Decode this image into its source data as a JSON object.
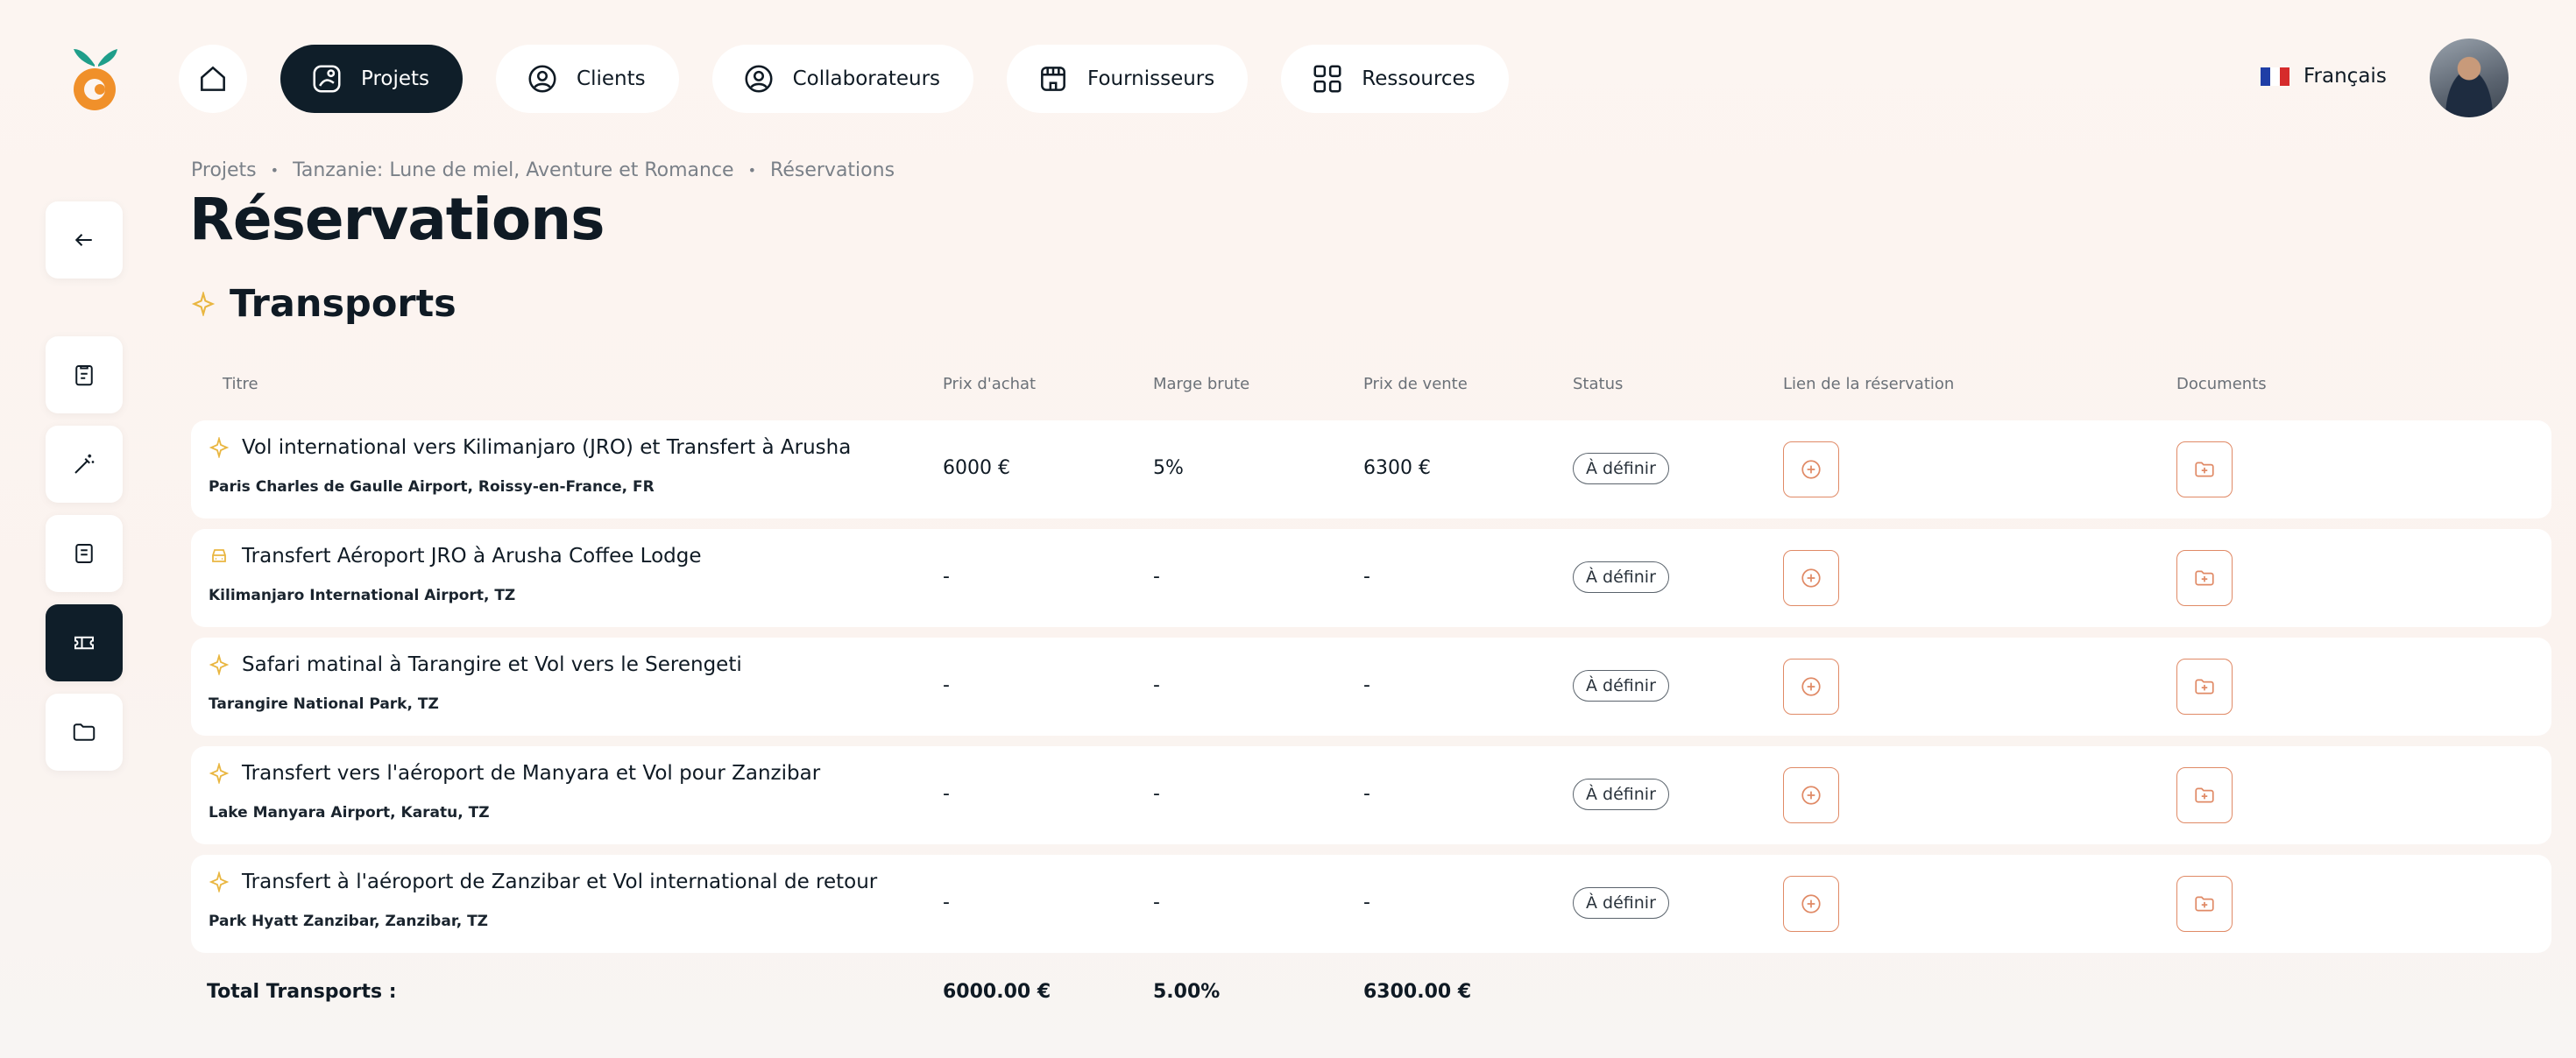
{
  "nav": {
    "items": [
      {
        "label": "Projets",
        "icon": "projects-icon",
        "active": true
      },
      {
        "label": "Clients",
        "icon": "user-circle-icon"
      },
      {
        "label": "Collaborateurs",
        "icon": "user-circle-icon"
      },
      {
        "label": "Fournisseurs",
        "icon": "store-icon"
      },
      {
        "label": "Ressources",
        "icon": "grid-icon"
      }
    ],
    "language": "Français"
  },
  "breadcrumb": [
    "Projets",
    "Tanzanie: Lune de miel, Aventure et Romance",
    "Réservations"
  ],
  "page_title": "Réservations",
  "section": {
    "title": "Transports",
    "icon": "plane-icon"
  },
  "table": {
    "headers": [
      "Titre",
      "Prix d'achat",
      "Marge brute",
      "Prix de vente",
      "Status",
      "Lien de la réservation",
      "Documents"
    ],
    "rows": [
      {
        "icon": "plane-icon",
        "title": "Vol international vers Kilimanjaro (JRO) et Transfert à Arusha",
        "location": "Paris Charles de Gaulle Airport, Roissy-en-France, FR",
        "purchase": "6000 €",
        "margin": "5%",
        "sale": "6300 €",
        "status": "À définir"
      },
      {
        "icon": "car-icon",
        "title": "Transfert Aéroport JRO à Arusha Coffee Lodge",
        "location": "Kilimanjaro International Airport, TZ",
        "purchase": "-",
        "margin": "-",
        "sale": "-",
        "status": "À définir"
      },
      {
        "icon": "plane-icon",
        "title": "Safari matinal à Tarangire et Vol vers le Serengeti",
        "location": "Tarangire National Park, TZ",
        "purchase": "-",
        "margin": "-",
        "sale": "-",
        "status": "À définir"
      },
      {
        "icon": "plane-icon",
        "title": "Transfert vers l'aéroport de Manyara et Vol pour Zanzibar",
        "location": "Lake Manyara Airport, Karatu, TZ",
        "purchase": "-",
        "margin": "-",
        "sale": "-",
        "status": "À définir"
      },
      {
        "icon": "plane-icon",
        "title": "Transfert à l'aéroport de Zanzibar et Vol international de retour",
        "location": "Park Hyatt Zanzibar, Zanzibar, TZ",
        "purchase": "-",
        "margin": "-",
        "sale": "-",
        "status": "À définir"
      }
    ],
    "totals": {
      "label": "Total Transports :",
      "purchase": "6000.00 €",
      "margin": "5.00%",
      "sale": "6300.00 €"
    }
  },
  "colors": {
    "accent": "#e08a66",
    "dark": "#0f1e29",
    "plane": "#e9b640"
  }
}
